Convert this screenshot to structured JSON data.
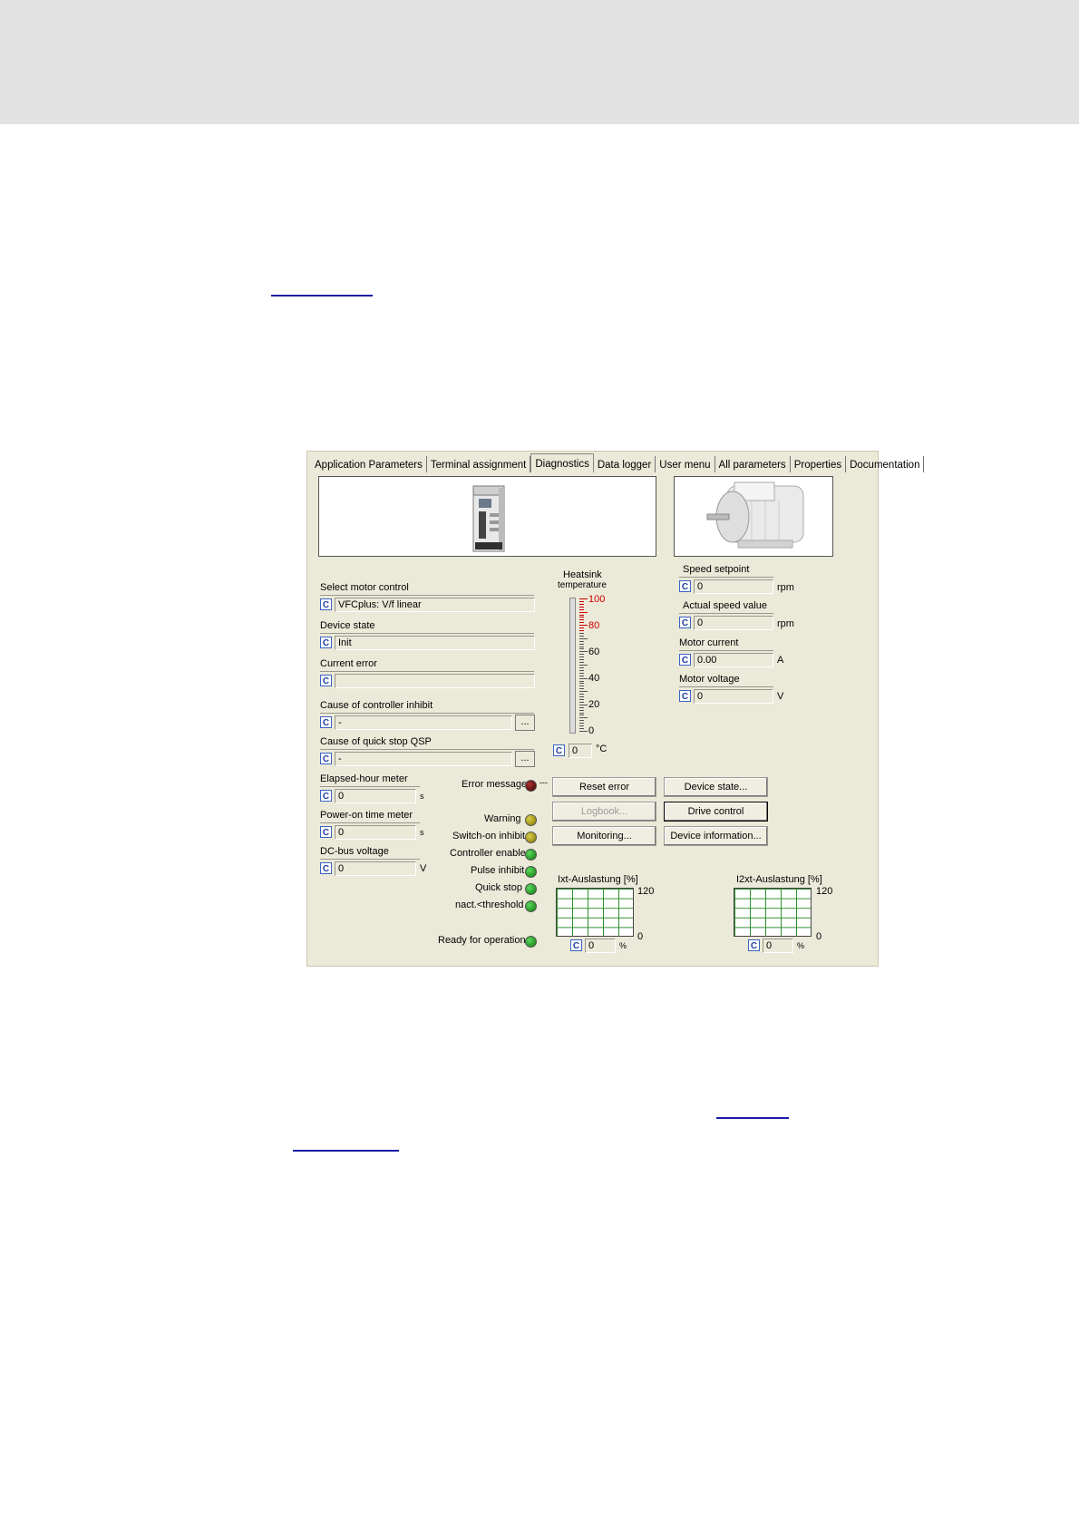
{
  "tabs": [
    "Application Parameters",
    "Terminal assignment",
    "Diagnostics",
    "Data logger",
    "User menu",
    "All parameters",
    "Properties",
    "Documentation"
  ],
  "active_tab": "Diagnostics",
  "c_label": "C",
  "left": {
    "motor_control": {
      "label": "Select motor control",
      "value": "VFCplus: V/f linear"
    },
    "device_state": {
      "label": "Device state",
      "value": "Init"
    },
    "current_error": {
      "label": "Current error",
      "value": ""
    },
    "controller_inhibit": {
      "label": "Cause of controller inhibit",
      "value": "-",
      "button": "..."
    },
    "quick_stop": {
      "label": "Cause of quick stop QSP",
      "value": "-",
      "button": "..."
    },
    "elapsed_hour": {
      "label": "Elapsed-hour meter",
      "value": "0",
      "unit": "s"
    },
    "power_on": {
      "label": "Power-on time meter",
      "value": "0",
      "unit": "s"
    },
    "dc_bus": {
      "label": "DC-bus voltage",
      "value": "0",
      "unit": "V"
    }
  },
  "heatsink": {
    "label_line1": "Heatsink",
    "label_line2": "temperature",
    "ticks": [
      "100",
      "80",
      "60",
      "40",
      "20",
      "0"
    ],
    "value": "0",
    "unit": "°C",
    "level_percent": 0,
    "red_color": "#cc0000"
  },
  "right": {
    "speed_setpoint": {
      "label": "Speed setpoint",
      "value": "0",
      "unit": "rpm"
    },
    "actual_speed": {
      "label": "Actual speed value",
      "value": "0",
      "unit": "rpm"
    },
    "motor_current": {
      "label": "Motor current",
      "value": "0.00",
      "unit": "A"
    },
    "motor_voltage": {
      "label": "Motor voltage",
      "value": "0",
      "unit": "V"
    }
  },
  "status": {
    "error_message": {
      "label": "Error message",
      "color": "dark-red",
      "suffix": "---"
    },
    "warning": {
      "label": "Warning",
      "color": "olive"
    },
    "switch_on_inhibit": {
      "label": "Switch-on inhibit",
      "color": "olive"
    },
    "controller_enable": {
      "label": "Controller enable",
      "color": "green"
    },
    "pulse_inhibit": {
      "label": "Pulse inhibit",
      "color": "green"
    },
    "quick_stop": {
      "label": "Quick stop",
      "color": "green"
    },
    "nact_threshold": {
      "label": "nact.<threshold",
      "color": "green"
    },
    "ready": {
      "label": "Ready for operation",
      "color": "green"
    }
  },
  "buttons": {
    "reset_error": "Reset error",
    "device_state": "Device state...",
    "logbook": "Logbook...",
    "drive_control": "Drive control",
    "monitoring": "Monitoring...",
    "device_information": "Device information..."
  },
  "utilization": {
    "ixt": {
      "title": "Ixt-Auslastung [%]",
      "max": "120",
      "min": "0",
      "value": "0",
      "unit": "%"
    },
    "i2xt": {
      "title": "I2xt-Auslastung [%]",
      "max": "120",
      "min": "0",
      "value": "0",
      "unit": "%"
    }
  },
  "colors": {
    "panel_bg": "#ebe9d8",
    "grid_line": "#2f8f2f",
    "link": "#1a1aa6",
    "top_band": "#e2e2e2"
  }
}
